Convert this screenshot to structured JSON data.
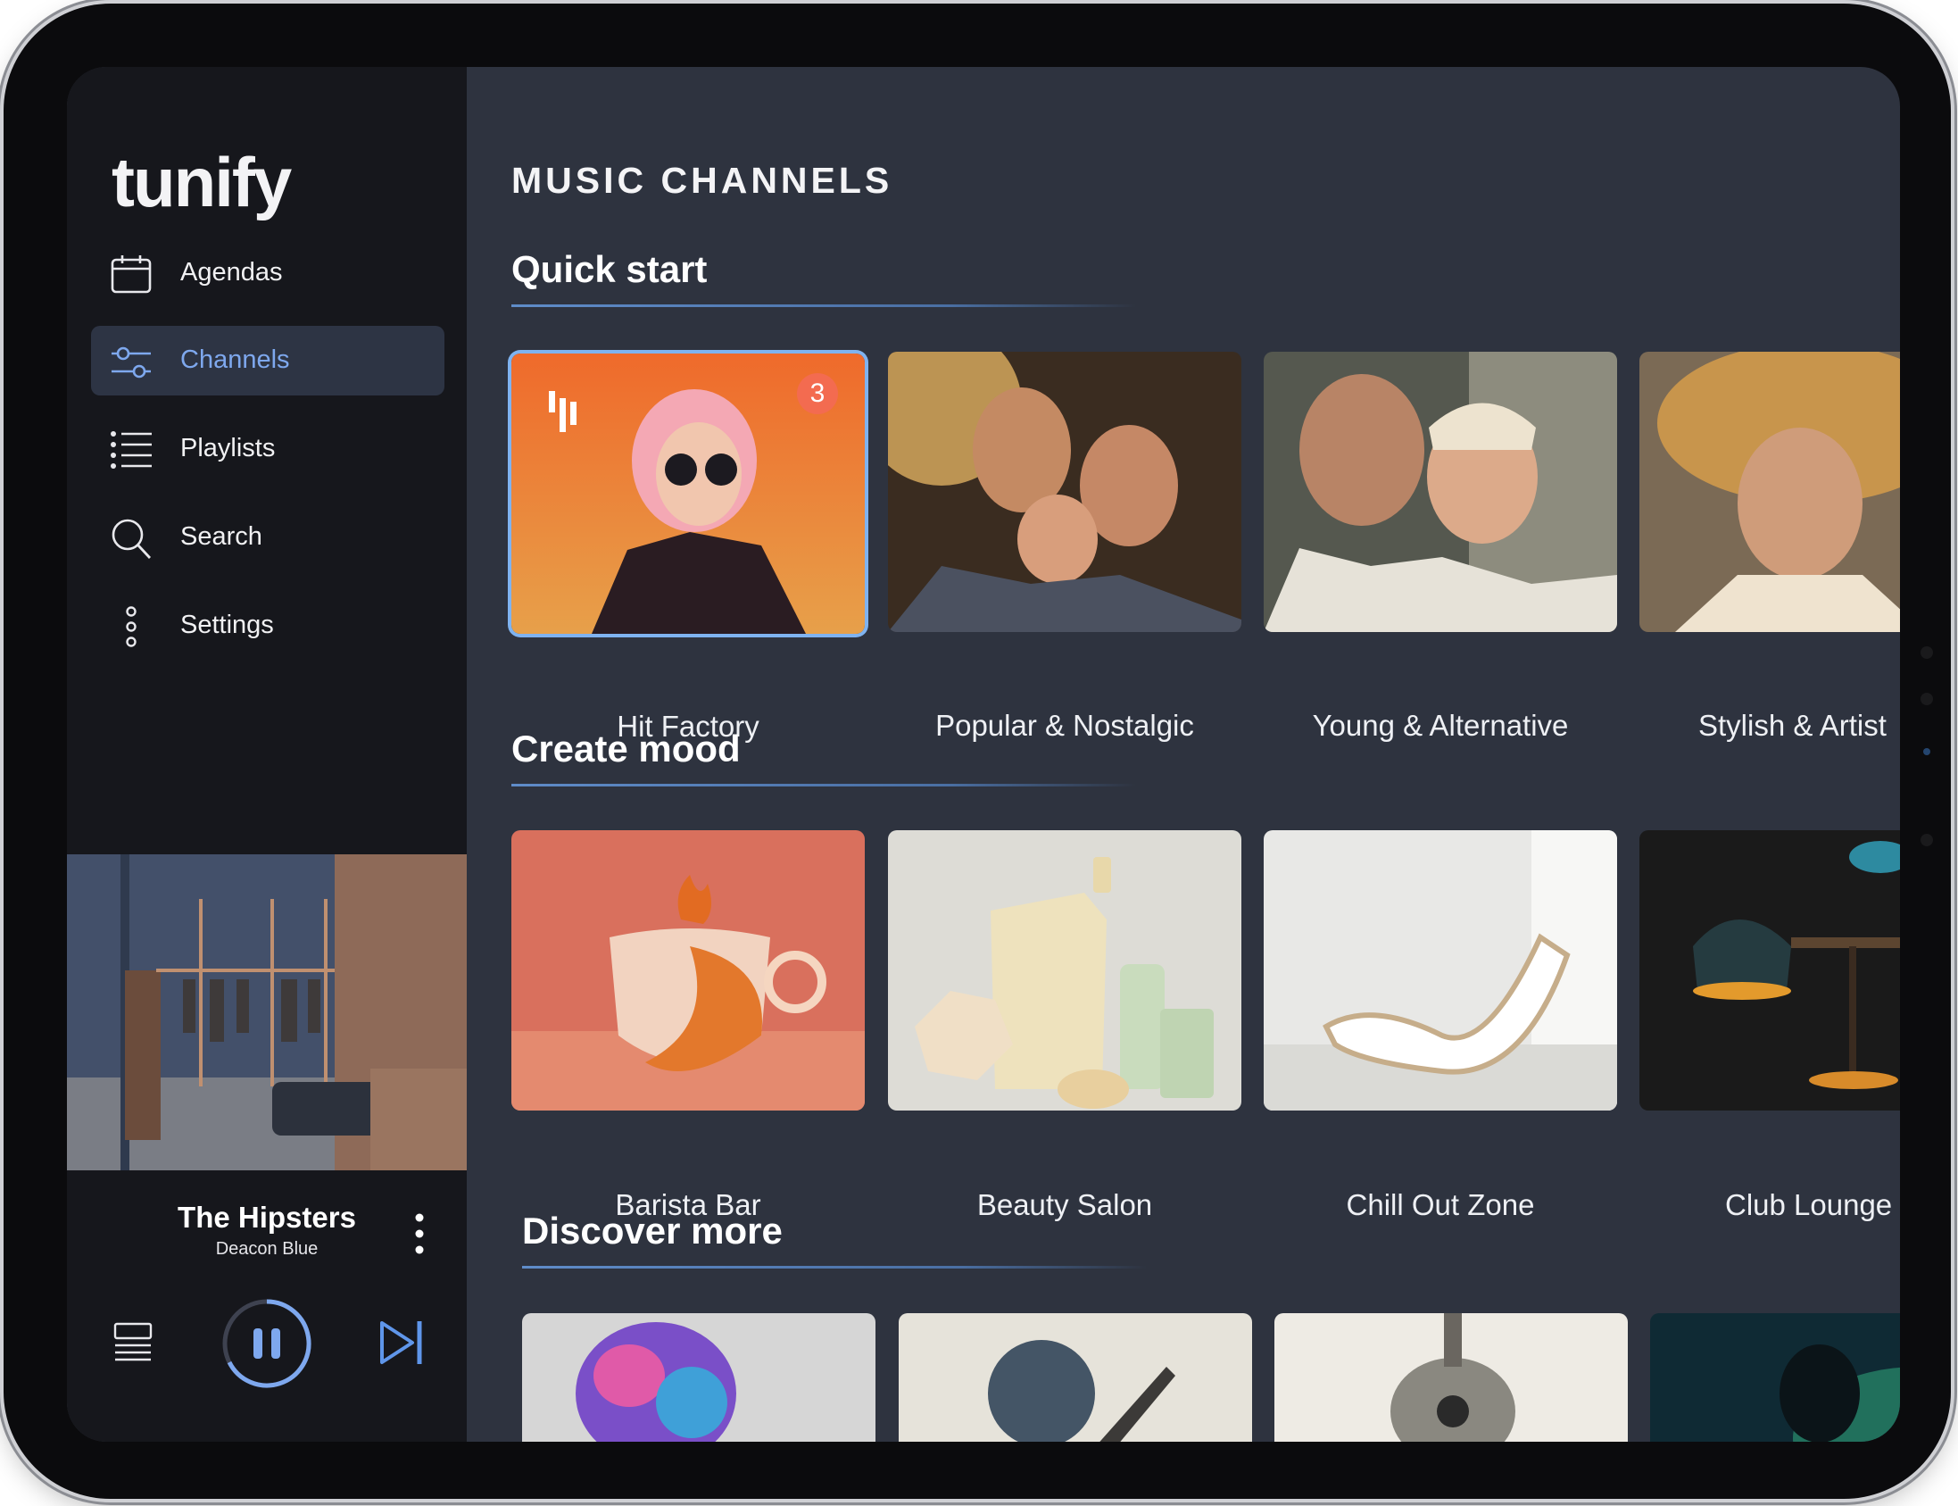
{
  "app": {
    "logo": "tunify"
  },
  "sidebar": {
    "items": [
      {
        "label": "Agendas",
        "icon": "calendar-icon",
        "active": false
      },
      {
        "label": "Channels",
        "icon": "channels-icon",
        "active": true
      },
      {
        "label": "Playlists",
        "icon": "list-icon",
        "active": false
      },
      {
        "label": "Search",
        "icon": "search-icon",
        "active": false
      },
      {
        "label": "Settings",
        "icon": "settings-icon",
        "active": false
      }
    ]
  },
  "now_playing": {
    "title": "The Hipsters",
    "artist": "Deacon Blue",
    "state": "playing"
  },
  "main": {
    "heading": "MUSIC CHANNELS",
    "sections": [
      {
        "title": "Quick start",
        "cards": [
          {
            "label": "Hit Factory",
            "badge": "3",
            "selected": true
          },
          {
            "label": "Popular & Nostalgic"
          },
          {
            "label": "Young & Alternative"
          },
          {
            "label": "Stylish & Artist"
          }
        ]
      },
      {
        "title": "Create mood",
        "cards": [
          {
            "label": "Barista Bar"
          },
          {
            "label": "Beauty Salon"
          },
          {
            "label": "Chill Out Zone"
          },
          {
            "label": "Club Lounge"
          }
        ]
      },
      {
        "title": "Discover more",
        "cards": [
          {},
          {},
          {},
          {}
        ]
      }
    ]
  },
  "colors": {
    "sidebar_bg": "#16171c",
    "main_bg": "#2e333f",
    "accent": "#7ea8ee",
    "badge": "#f36b50"
  }
}
